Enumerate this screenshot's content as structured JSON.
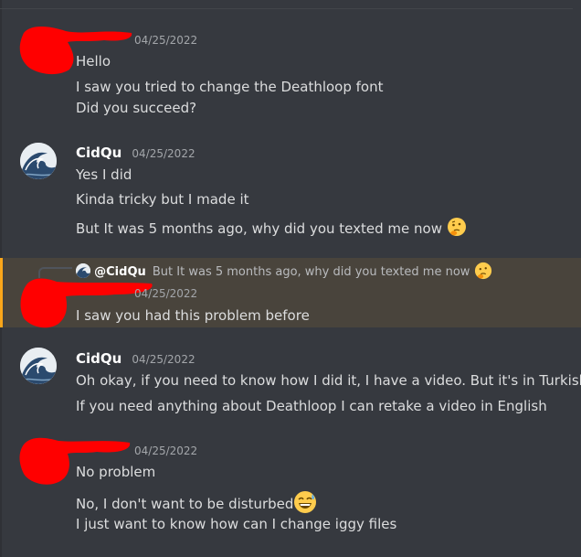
{
  "messages": [
    {
      "username": "",
      "timestamp": "04/25/2022",
      "lines": [
        "Hello",
        "I saw you tried to change the Deathloop font",
        "Did you succeed?"
      ]
    },
    {
      "username": "CidQu",
      "timestamp": "04/25/2022",
      "lines": [
        "Yes I did",
        "Kinda tricky but I made it",
        "But It was 5 months ago, why did you texted me now"
      ],
      "emoji": "thinking-face"
    },
    {
      "username": "",
      "timestamp": "04/25/2022",
      "reply": {
        "username": "@CidQu",
        "text": "But It was 5 months ago, why did you texted me now",
        "emoji": "thinking-face"
      },
      "lines": [
        "I saw you had this problem before"
      ],
      "highlighted": true
    },
    {
      "username": "CidQu",
      "timestamp": "04/25/2022",
      "lines": [
        "Oh okay, if you need to know how I did it, I have a video. But it's in Turkish",
        "If you need anything about Deathloop I can retake a video in English"
      ]
    },
    {
      "username": "",
      "timestamp": "04/25/2022",
      "lines": [
        "No problem",
        "No, I don't want to be disturbed",
        "I just want to know how can I change iggy files"
      ],
      "emoji": "grinning-sweat-face"
    }
  ],
  "colors": {
    "background": "#36393f",
    "highlight_background": "#49443c",
    "highlight_bar": "#faa61a",
    "text": "#dcddde",
    "username": "#ffffff",
    "timestamp": "#a3a6aa",
    "redaction": "#ff0000"
  }
}
